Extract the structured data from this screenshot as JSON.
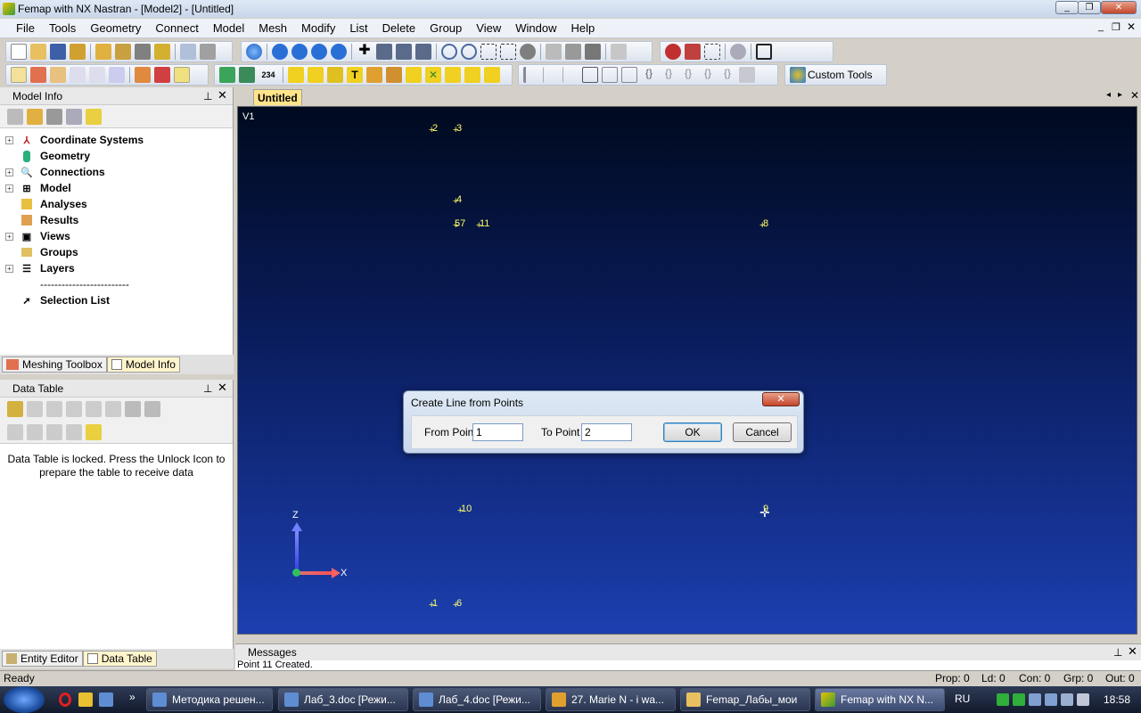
{
  "window": {
    "title": "Femap with NX Nastran - [Model2] - [Untitled]"
  },
  "menu": [
    "File",
    "Tools",
    "Geometry",
    "Connect",
    "Model",
    "Mesh",
    "Modify",
    "List",
    "Delete",
    "Group",
    "View",
    "Window",
    "Help"
  ],
  "toolbar": {
    "custom_tools_label": "Custom Tools",
    "node_count_label": "234"
  },
  "model_info": {
    "title": "Model Info",
    "items": [
      {
        "label": "Coordinate Systems",
        "icon": "axes-icon"
      },
      {
        "label": "Geometry",
        "icon": "cylinder-icon"
      },
      {
        "label": "Connections",
        "icon": "connection-icon"
      },
      {
        "label": "Model",
        "icon": "grid-icon"
      },
      {
        "label": "Analyses",
        "icon": "analysis-icon"
      },
      {
        "label": "Results",
        "icon": "results-icon"
      },
      {
        "label": "Views",
        "icon": "view-icon"
      },
      {
        "label": "Groups",
        "icon": "groups-icon"
      },
      {
        "label": "Layers",
        "icon": "layers-icon"
      }
    ],
    "separator": "-------------------------",
    "selection_list": "Selection List"
  },
  "bottom_tabs_upper": [
    "Meshing Toolbox",
    "Model Info"
  ],
  "data_table": {
    "title": "Data Table",
    "locked_message": "Data Table is locked. Press the Unlock Icon to prepare the table to receive data"
  },
  "bottom_tabs_lower": [
    "Entity Editor",
    "Data Table"
  ],
  "graphics": {
    "tab": "Untitled",
    "view_label": "V1",
    "axis_z": "Z",
    "axis_x": "X",
    "point_labels": [
      "2",
      "3",
      "4",
      "57",
      "11",
      "8",
      "10",
      "9",
      "1",
      "6"
    ]
  },
  "dialog": {
    "title": "Create Line from Points",
    "from_label": "From Point",
    "from_value": "1",
    "to_label": "To Point",
    "to_value": "2",
    "ok": "OK",
    "cancel": "Cancel",
    "close": "✕"
  },
  "messages": {
    "title": "Messages",
    "last_line": "Point 11 Created."
  },
  "status": {
    "ready": "Ready",
    "prop": "Prop: 0",
    "ld": "Ld: 0",
    "con": "Con: 0",
    "grp": "Grp: 0",
    "out": "Out: 0"
  },
  "taskbar": {
    "tasks": [
      "Методика решен...",
      "Лаб_3.doc [Режи...",
      "Лаб_4.doc [Режи...",
      "27. Marie N  - i wa...",
      "Femap_Лабы_мои",
      "Femap with NX N..."
    ],
    "lang": "RU",
    "time": "18:58"
  },
  "colors": {
    "viewport_top": "#000a1f",
    "viewport_bottom": "#1c3fb0",
    "node_label": "#ffff66"
  }
}
